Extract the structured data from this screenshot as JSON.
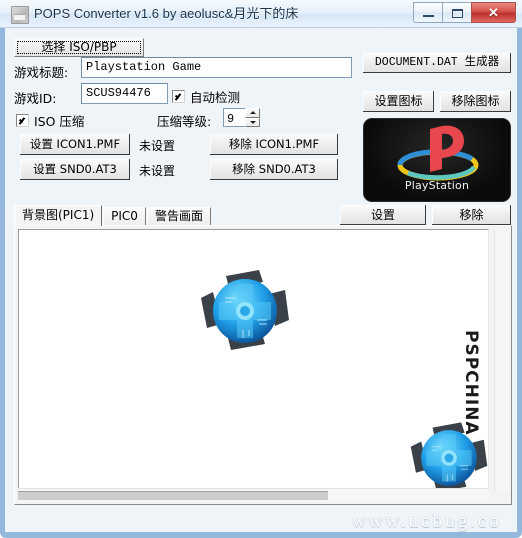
{
  "window": {
    "title": "POPS Converter v1.6 by aeolusc&月光下的床",
    "icon": "app-icon",
    "controls": {
      "minimize": "–",
      "maximize": "□",
      "close": "✕"
    }
  },
  "form": {
    "select_iso_button": "选择 ISO/PBP",
    "document_dat_button": "DOCUMENT.DAT 生成器",
    "game_title_label": "游戏标题:",
    "game_title_value": "Playstation Game",
    "game_id_label": "游戏ID:",
    "game_id_value": "SCUS94476",
    "auto_detect_label": "自动检测",
    "auto_detect_checked": true,
    "set_icon_button": "设置图标",
    "remove_icon_button": "移除图标",
    "iso_compress_label": "ISO 压缩",
    "iso_compress_checked": true,
    "compress_level_label": "压缩等级:",
    "compress_level_value": "9",
    "set_icon1_button": "设置 ICON1.PMF",
    "icon1_status": "未设置",
    "remove_icon1_button": "移除 ICON1.PMF",
    "set_snd0_button": "设置 SND0.AT3",
    "snd0_status": "未设置",
    "remove_snd0_button": "移除 SND0.AT3"
  },
  "logo": {
    "brand_text": "PlayStation",
    "p_color": "#e8484d",
    "ellipse_colors": [
      "#f0c419",
      "#2f8fd6",
      "#5ec8c0"
    ],
    "background": "#0d0d0d"
  },
  "tabs": [
    {
      "label": "背景图(PIC1)",
      "active": true
    },
    {
      "label": "PIC0",
      "active": false
    },
    {
      "label": "警告画面",
      "active": false
    }
  ],
  "tab_actions": {
    "set_button": "设置",
    "remove_button": "移除"
  },
  "canvas": {
    "watermark_text": "PSPCHINA",
    "emblem_name": "blue-tech-emblem",
    "emblem_color": "#1f9fe8"
  },
  "footer": {
    "site_watermark": "www.ucbug.co"
  }
}
